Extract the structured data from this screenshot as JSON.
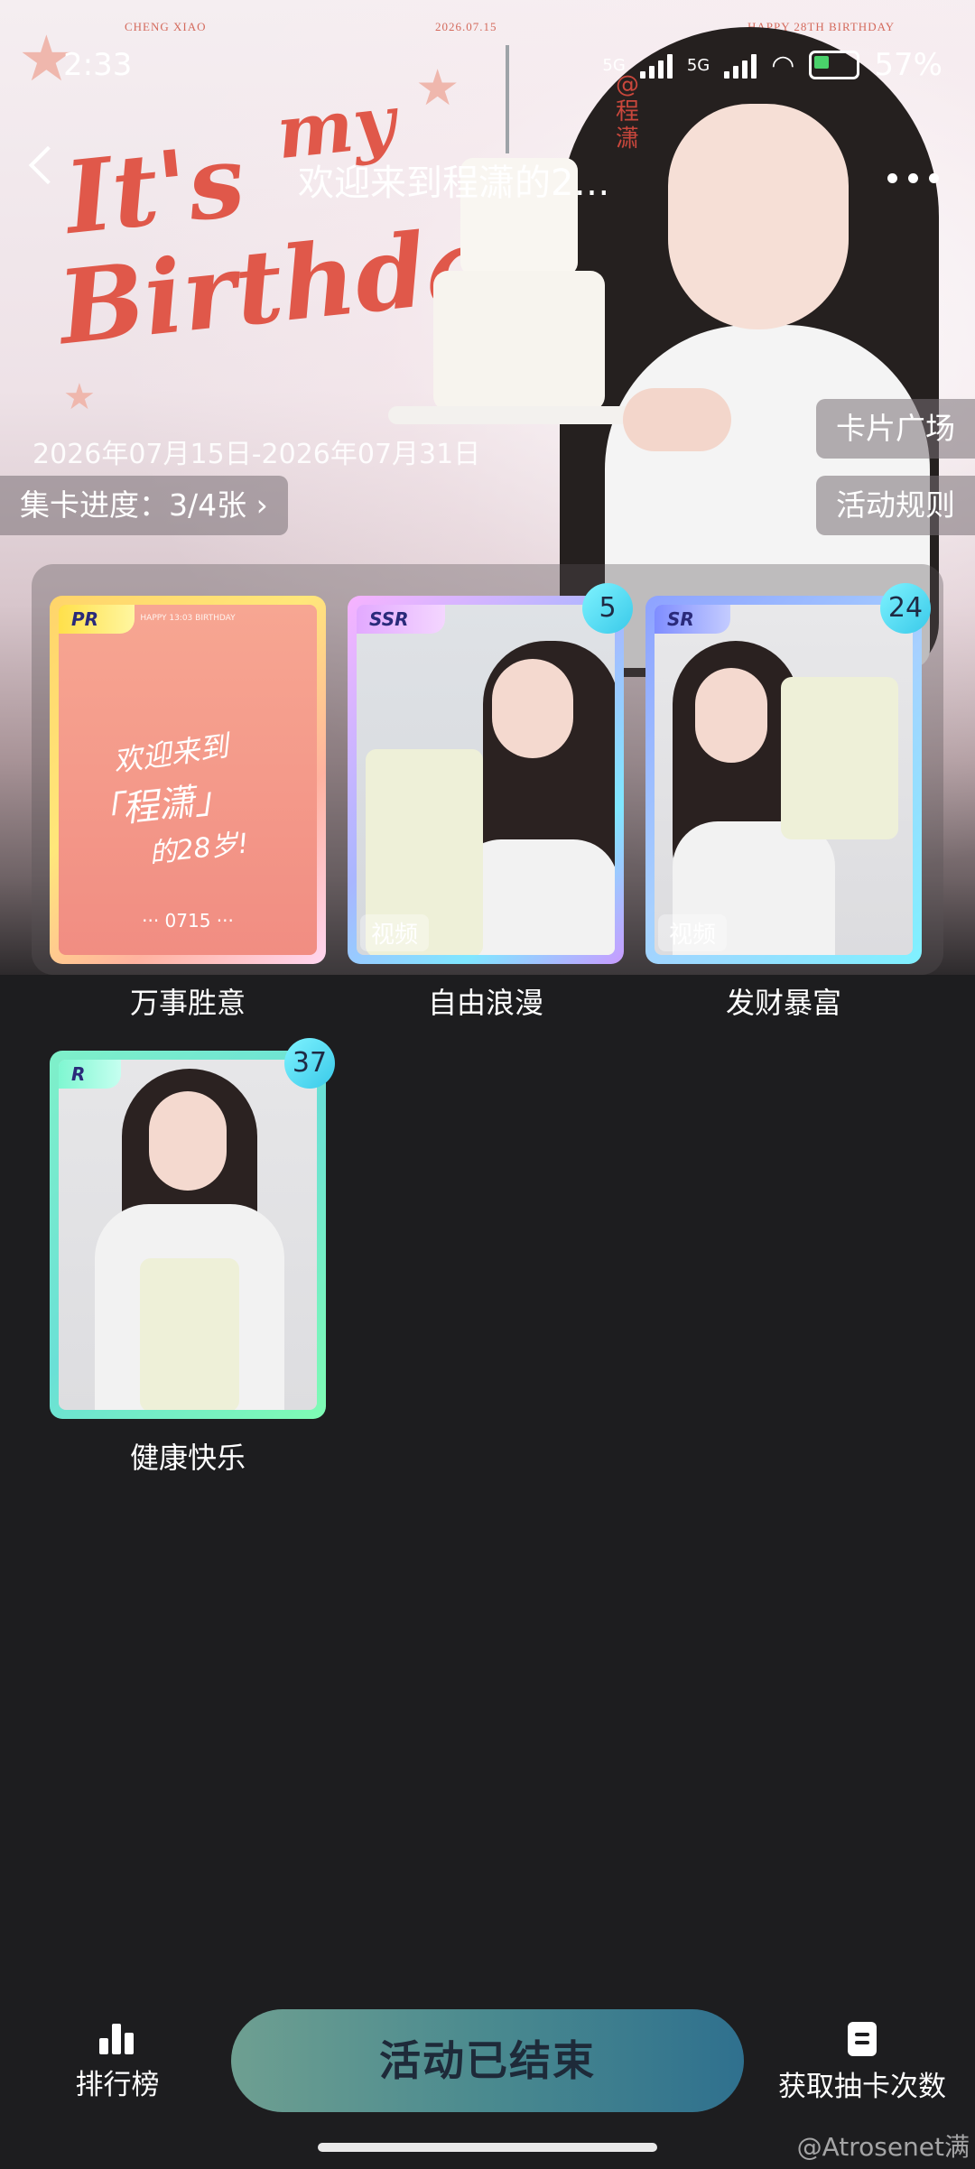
{
  "status_bar": {
    "time": "2:33",
    "network1": "5G",
    "network2": "5G",
    "battery": "57%"
  },
  "nav": {
    "title": "欢迎来到程潇的2…"
  },
  "banner": {
    "top_left": "CHENG XIAO",
    "top_center": "2026.07.15",
    "top_right": "HAPPY 28TH BIRTHDAY",
    "script_line1": "It's",
    "script_line2": "Birthday!",
    "script_word": "my",
    "vertical_name": "@程潇",
    "date_range": "2026年07月15日-2026年07月31日",
    "progress_chip": "集卡进度：3/4张 ›",
    "card_square_chip": "卡片广场",
    "rules_chip": "活动规则"
  },
  "cards": [
    {
      "rarity": "PR",
      "label": "万事胜意",
      "count": null,
      "video": null,
      "art_text1": "欢迎来到",
      "art_text2": "「程潇」",
      "art_text3": "的28岁!",
      "art_date": "··· 0715 ···",
      "art_header": "HAPPY 13:03 BIRTHDAY"
    },
    {
      "rarity": "SSR",
      "label": "自由浪漫",
      "count": "5",
      "video": "视频"
    },
    {
      "rarity": "SR",
      "label": "发财暴富",
      "count": "24",
      "video": "视频"
    },
    {
      "rarity": "R",
      "label": "健康快乐",
      "count": "37",
      "video": null
    }
  ],
  "bottom": {
    "ranking_label": "排行榜",
    "main_button": "活动已结束",
    "draws_label": "获取抽卡次数"
  },
  "watermark": "@Atrosenet满"
}
